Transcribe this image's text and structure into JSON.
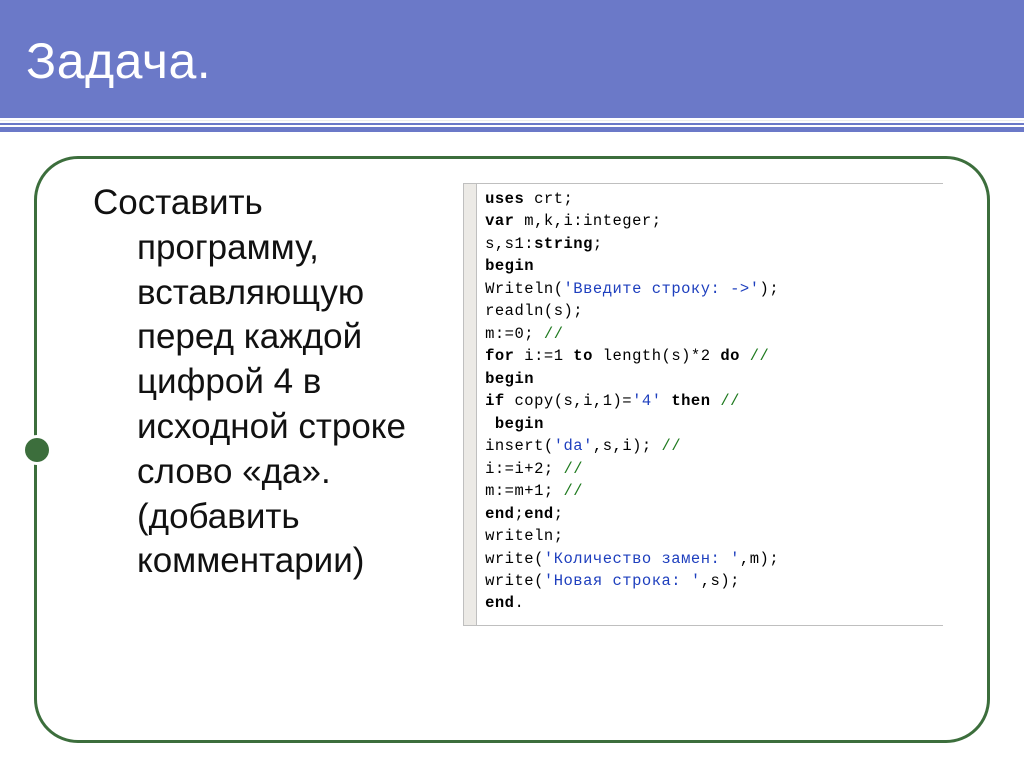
{
  "title": "Задача.",
  "task_text": "Составить программу, вставляющую перед каждой цифрой 4 в исходной строке слово «да». (добавить комментарии)",
  "code": {
    "l1": {
      "a": "uses",
      "b": " crt;"
    },
    "l2": {
      "a": "var",
      "b": " m,k,i:integer;"
    },
    "l3": {
      "a": "s,s1:",
      "b": "string",
      "c": ";"
    },
    "l4": "begin",
    "l5": {
      "a": "Writeln(",
      "s": "'Введите строку: ->'",
      "c": ");"
    },
    "l6": "readln(s);",
    "l7": {
      "a": "m:=0; ",
      "cm": "//"
    },
    "l8": {
      "a": "for",
      "b": " i:=1 ",
      "c": "to",
      "d": " length(s)*2 ",
      "e": "do",
      "cm": " //"
    },
    "l9": "begin",
    "l10": {
      "a": "if",
      "b": " copy(s,i,1)=",
      "s": "'4'",
      "c": " ",
      "d": "then",
      "cm": " //"
    },
    "l11": " begin",
    "l12": {
      "a": "insert(",
      "s": "'da'",
      "b": ",s,i); ",
      "cm": "//"
    },
    "l13": {
      "a": "i:=i+2; ",
      "cm": "//"
    },
    "l14": {
      "a": "m:=m+1; ",
      "cm": "//"
    },
    "l15": {
      "a": "end",
      "b": ";",
      "c": "end",
      "d": ";"
    },
    "l16": "writeln;",
    "l17": {
      "a": "write(",
      "s": "'Количество замен: '",
      "b": ",m);"
    },
    "l18": {
      "a": "write(",
      "s": "'Новая строка: '",
      "b": ",s);"
    },
    "l19": {
      "a": "end",
      "b": "."
    }
  }
}
